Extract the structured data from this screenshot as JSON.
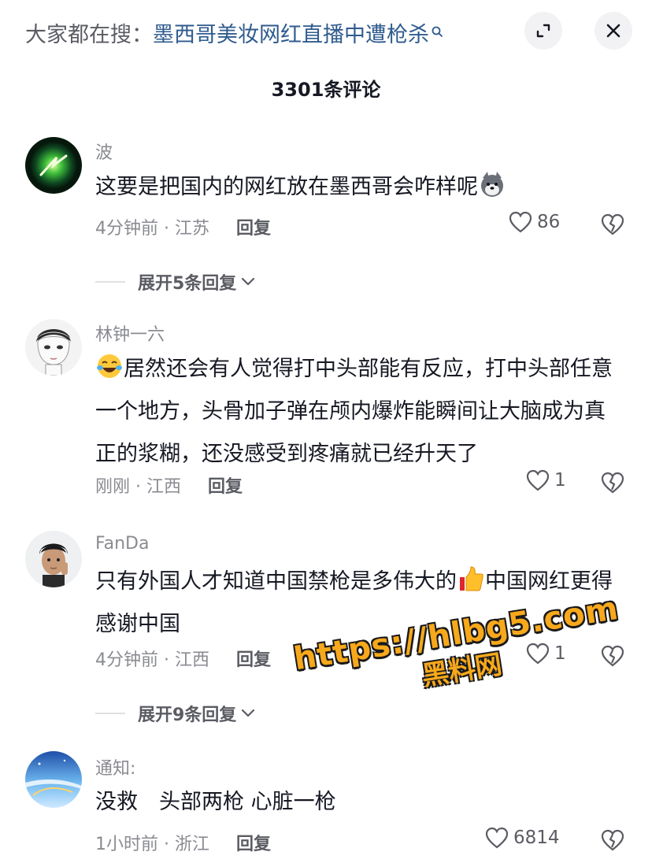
{
  "header": {
    "search_prefix": "大家都在搜：",
    "search_query": "墨西哥美妆网红直播中遭枪杀",
    "count_label": "3301条评论"
  },
  "comments": [
    {
      "user": "波",
      "text": "这要是把国内的网红放在墨西哥会咋样呢",
      "emoji": "wolf-emoji",
      "meta": "4分钟前 · 江苏",
      "reply": "回复",
      "likes": "86",
      "expand": "展开5条回复"
    },
    {
      "user": "林钟一六",
      "emoji": "laughing-crying-emoji",
      "text": "居然还会有人觉得打中头部能有反应，打中头部任意一个地方，头骨加子弹在颅内爆炸能瞬间让大脑成为真正的浆糊，还没感受到疼痛就已经升天了",
      "meta": "刚刚 · 江西",
      "reply": "回复",
      "likes": "1"
    },
    {
      "user": "FanDa",
      "text_before": "只有外国人才知道中国禁枪是多伟大的",
      "emoji": "thumbs-up-emoji",
      "text_after": "中国网红更得感谢中国",
      "meta": "4分钟前 · 江西",
      "reply": "回复",
      "likes": "1",
      "expand": "展开9条回复"
    },
    {
      "user": "通知:",
      "text": "没救　头部两枪 心脏一枪",
      "meta": "1小时前 · 浙江",
      "reply": "回复",
      "likes": "6814"
    }
  ],
  "watermark": {
    "url": "https://hlbg5.com",
    "label": "黑料网"
  },
  "colors": {
    "link": "#2f5b8e",
    "muted": "#8a8b91",
    "watermark": "#f7a81b"
  }
}
